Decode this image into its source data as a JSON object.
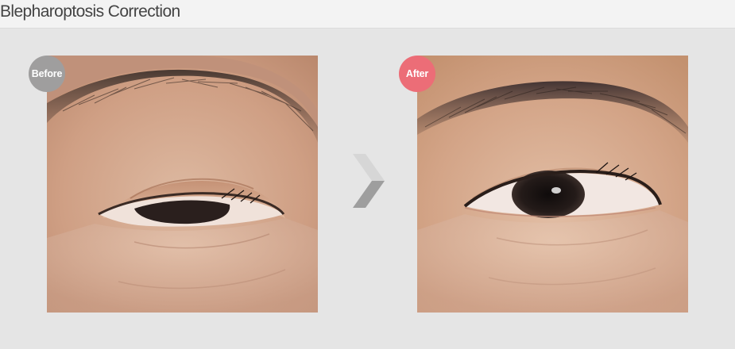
{
  "header": {
    "title": "Blepharoptosis Correction"
  },
  "comparison": {
    "before_label": "Before",
    "after_label": "After"
  },
  "colors": {
    "before_badge": "#9f9e9e",
    "after_badge": "#ec6d77",
    "arrow": "#a8a8a8",
    "background": "#e5e5e5"
  },
  "icons": {
    "arrow": "chevron-right-icon"
  }
}
